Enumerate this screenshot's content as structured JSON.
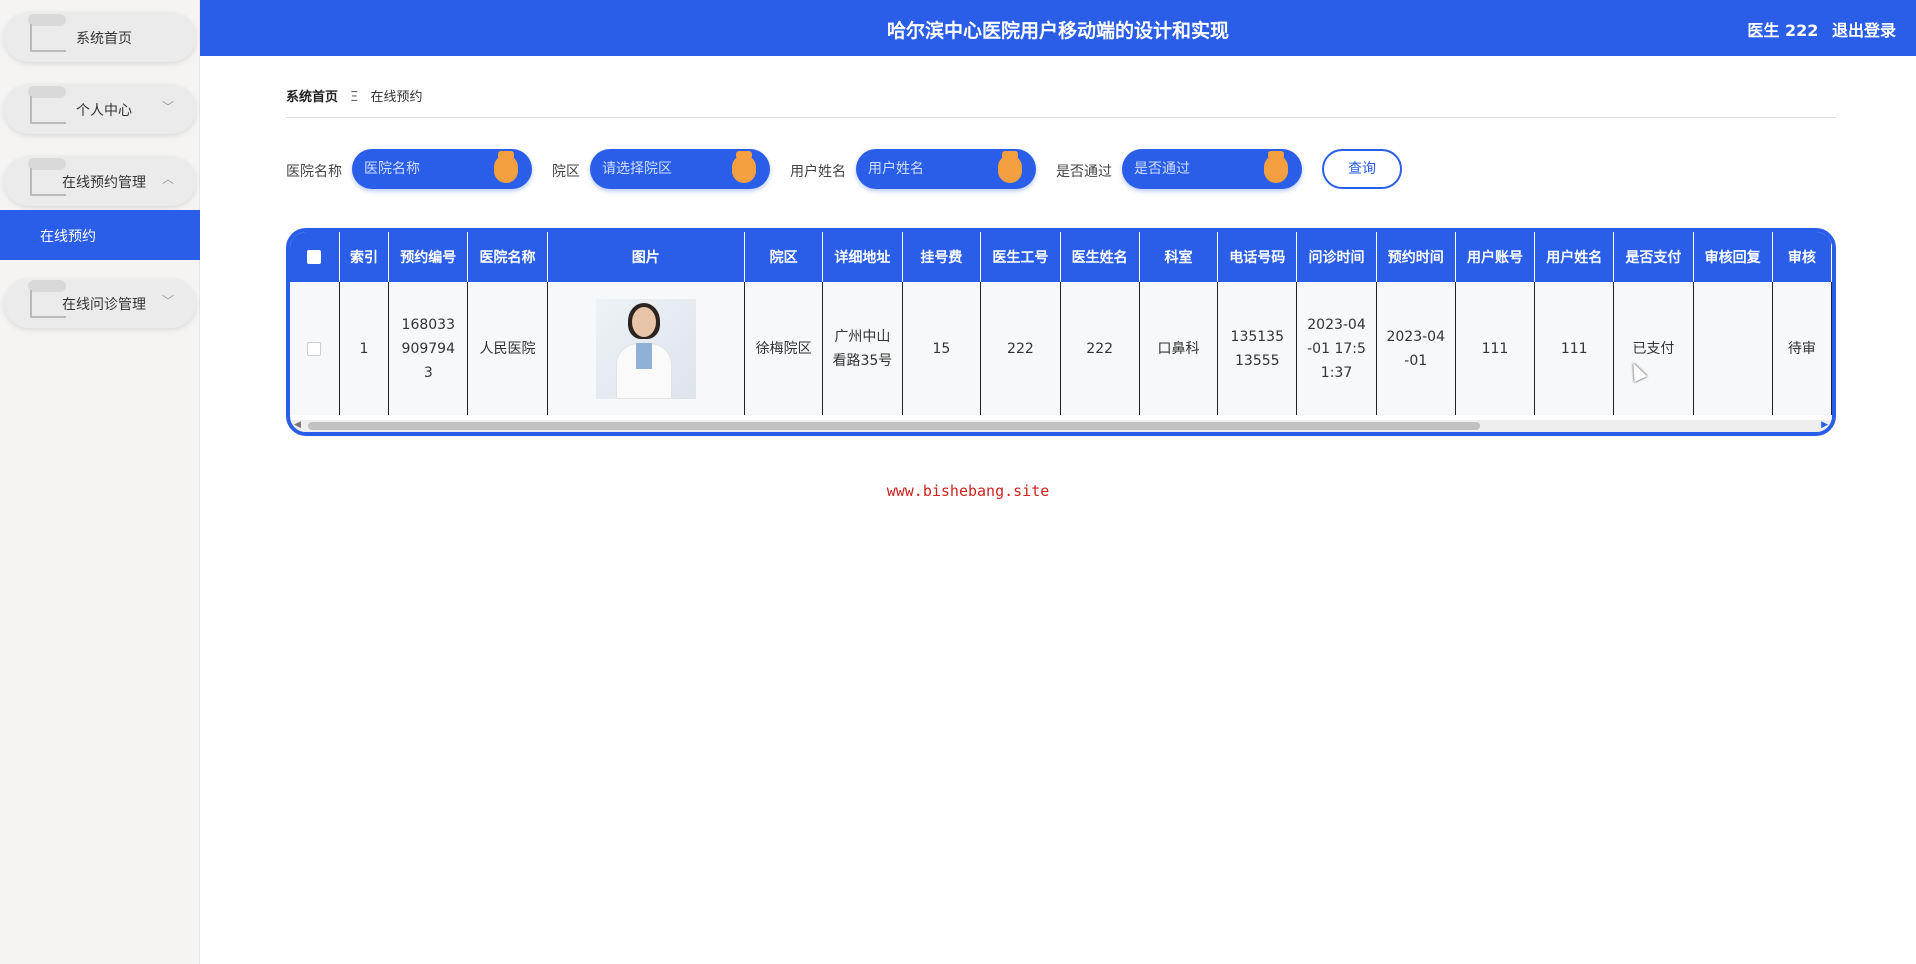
{
  "sidebar": {
    "items": [
      {
        "label": "系统首页",
        "chevron": ""
      },
      {
        "label": "个人中心",
        "chevron": "﹀"
      },
      {
        "label": "在线预约管理",
        "chevron": "︿"
      },
      {
        "label": "在线问诊管理",
        "chevron": "﹀"
      }
    ],
    "active_sub": "在线预约"
  },
  "header": {
    "title": "哈尔滨中心医院用户移动端的设计和实现",
    "user": "医生 222",
    "logout": "退出登录"
  },
  "breadcrumb": {
    "home": "系统首页",
    "sep": "Ξ",
    "current": "在线预约"
  },
  "search": {
    "fields": [
      {
        "label": "医院名称",
        "placeholder": "医院名称"
      },
      {
        "label": "院区",
        "placeholder": "请选择院区"
      },
      {
        "label": "用户姓名",
        "placeholder": "用户姓名"
      },
      {
        "label": "是否通过",
        "placeholder": "是否通过"
      }
    ],
    "query_button": "查询"
  },
  "table": {
    "headers": [
      "索引",
      "预约编号",
      "医院名称",
      "图片",
      "院区",
      "详细地址",
      "挂号费",
      "医生工号",
      "医生姓名",
      "科室",
      "电话号码",
      "问诊时间",
      "预约时间",
      "用户账号",
      "用户姓名",
      "是否支付",
      "审核回复",
      "审核"
    ],
    "rows": [
      {
        "index": "1",
        "order_no": "1680339097943",
        "hospital": "人民医院",
        "campus": "徐梅院区",
        "address": "广州中山看路35号",
        "fee": "15",
        "doctor_id": "222",
        "doctor_name": "222",
        "dept": "口鼻科",
        "phone": "13513513555",
        "consult_time": "2023-04-01 17:51:37",
        "appoint_time": "2023-04-01",
        "user_account": "111",
        "user_name": "111",
        "paid": "已支付",
        "review_reply": "",
        "review": "待审"
      }
    ]
  },
  "watermark": "www.bishebang.site",
  "colors": {
    "primary": "#2a5ee8",
    "accent": "#f4a040",
    "watermark": "#cc2222"
  }
}
